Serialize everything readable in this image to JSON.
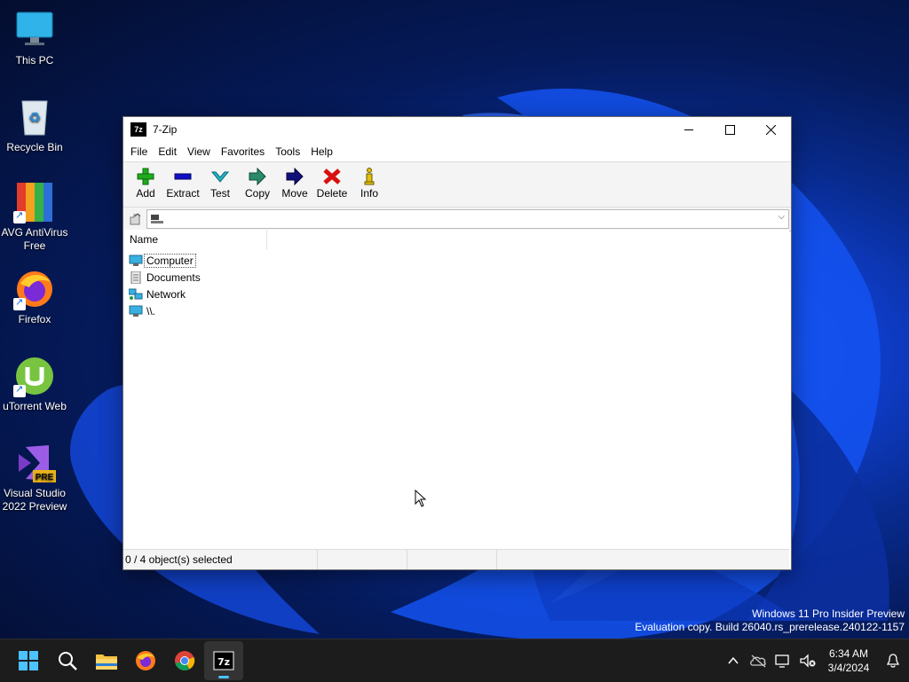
{
  "desktop": {
    "icons": [
      {
        "label": "This PC"
      },
      {
        "label": "Recycle Bin"
      },
      {
        "label": "AVG AntiVirus Free"
      },
      {
        "label": "Firefox"
      },
      {
        "label": "uTorrent Web"
      },
      {
        "label": "Visual Studio 2022 Preview"
      }
    ]
  },
  "window": {
    "title": "7-Zip",
    "app_icon_text": "7z",
    "menu": [
      "File",
      "Edit",
      "View",
      "Favorites",
      "Tools",
      "Help"
    ],
    "toolbar": [
      {
        "label": "Add",
        "icon": "plus-icon",
        "color": "#1faa1f"
      },
      {
        "label": "Extract",
        "icon": "minus-icon",
        "color": "#1010c8"
      },
      {
        "label": "Test",
        "icon": "check-icon",
        "color": "#22b6c8"
      },
      {
        "label": "Copy",
        "icon": "arrow-right-icon",
        "color": "#2a8a6a"
      },
      {
        "label": "Move",
        "icon": "arrow-right-icon",
        "color": "#10107a"
      },
      {
        "label": "Delete",
        "icon": "x-icon",
        "color": "#d81010"
      },
      {
        "label": "Info",
        "icon": "info-icon",
        "color": "#e0c010"
      }
    ],
    "address": {
      "value": ""
    },
    "columns": {
      "name": "Name"
    },
    "items": [
      {
        "label": "Computer",
        "icon": "computer-icon"
      },
      {
        "label": "Documents",
        "icon": "documents-icon"
      },
      {
        "label": "Network",
        "icon": "network-icon"
      },
      {
        "label": "\\\\.",
        "icon": "computer-icon"
      }
    ],
    "status": {
      "selected": "0 / 4 object(s) selected"
    }
  },
  "watermark": {
    "line1": "Windows 11 Pro Insider Preview",
    "line2": "Evaluation copy. Build 26040.rs_prerelease.240122-1157"
  },
  "taskbar": {
    "pinned": [
      "windows-start-icon",
      "search-icon",
      "file-explorer-icon",
      "firefox-icon",
      "chrome-icon",
      "7zip-icon"
    ],
    "time": "6:34 AM",
    "date": "3/4/2024"
  }
}
